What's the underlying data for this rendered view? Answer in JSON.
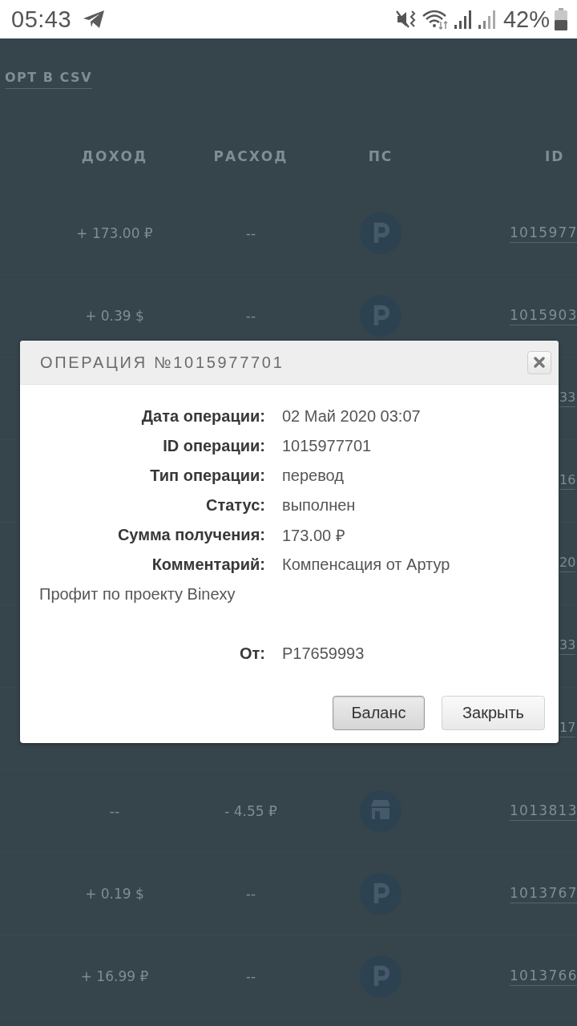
{
  "status_bar": {
    "time": "05:43",
    "battery": "42%"
  },
  "page": {
    "export_link": "ОРТ В CSV",
    "table": {
      "columns": [
        "ДОХОД",
        "РАСХОД",
        "ПС",
        "ID"
      ],
      "rows": [
        {
          "kind": "full",
          "income": "+ 173.00 ₽",
          "expense": "--",
          "ps": {
            "kind": "letter"
          },
          "id": "1015977"
        },
        {
          "kind": "full",
          "income": "+ 0.39 $",
          "expense": "--",
          "ps": {
            "kind": "letter"
          },
          "id": "1015903"
        },
        {
          "kind": "hidden",
          "id": "33"
        },
        {
          "kind": "hidden",
          "id": "16"
        },
        {
          "kind": "hidden",
          "id": "20"
        },
        {
          "kind": "hidden",
          "id": "33"
        },
        {
          "kind": "hidden",
          "id": "17"
        },
        {
          "kind": "full",
          "income": "--",
          "expense": "- 4.55 ₽",
          "ps": {
            "kind": "shop"
          },
          "id": "1013813"
        },
        {
          "kind": "full",
          "income": "+ 0.19 $",
          "expense": "--",
          "ps": {
            "kind": "letter"
          },
          "id": "1013767"
        },
        {
          "kind": "full",
          "income": "+ 16.99 ₽",
          "expense": "--",
          "ps": {
            "kind": "letter"
          },
          "id": "1013766"
        }
      ]
    }
  },
  "dialog": {
    "title": "ОПЕРАЦИЯ №1015977701",
    "fields": [
      {
        "kind": "field",
        "label": "Дата операции:",
        "value": "02 Май 2020 03:07"
      },
      {
        "kind": "field",
        "label": "ID операции:",
        "value": "1015977701"
      },
      {
        "kind": "field",
        "label": "Тип операции:",
        "value": "перевод"
      },
      {
        "kind": "field",
        "label": "Статус:",
        "value": "выполнен"
      },
      {
        "kind": "field",
        "label": "Сумма получения:",
        "value": "173.00 ₽"
      },
      {
        "kind": "field",
        "label": "Комментарий:",
        "value": "Компенсация от Артур"
      },
      {
        "kind": "note",
        "text": "Профит по проекту Binexy"
      },
      {
        "kind": "field",
        "label": "От:",
        "value": "P17659993"
      }
    ],
    "buttons": [
      {
        "label": "Баланс",
        "focused": true
      },
      {
        "label": "Закрыть",
        "focused": false
      }
    ]
  }
}
